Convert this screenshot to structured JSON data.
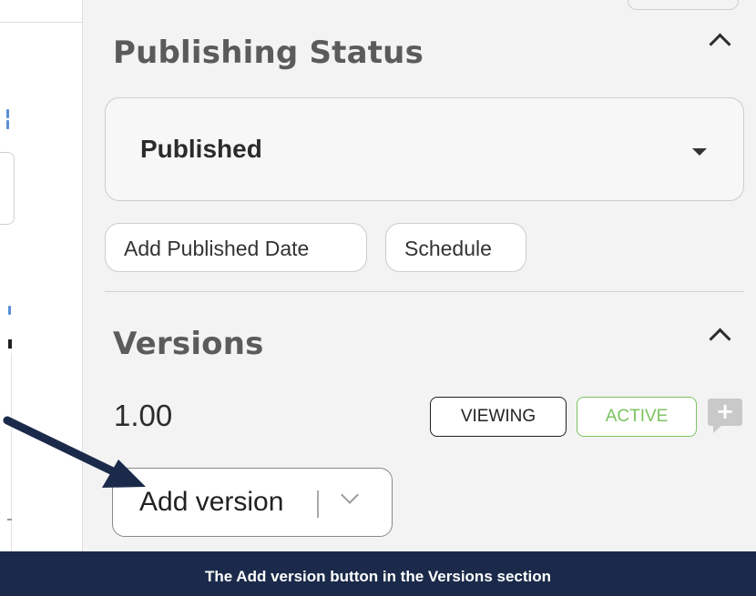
{
  "publishing_status": {
    "title": "Publishing Status",
    "selected_status": "Published",
    "add_published_date_label": "Add Published Date",
    "schedule_label": "Schedule"
  },
  "versions": {
    "title": "Versions",
    "current_version": "1.00",
    "viewing_badge": "VIEWING",
    "active_badge": "ACTIVE",
    "add_version_label": "Add version"
  },
  "caption": "The Add version button in the Versions section",
  "colors": {
    "panel_bg": "#f3f3f3",
    "active_green": "#7bc45f",
    "caption_bg": "#1b2a4a",
    "arrow": "#1b2a4a"
  },
  "icons": [
    "chevron-up-icon",
    "caret-down-icon",
    "add-comment-icon",
    "chevron-down-icon",
    "annotation-arrow"
  ]
}
